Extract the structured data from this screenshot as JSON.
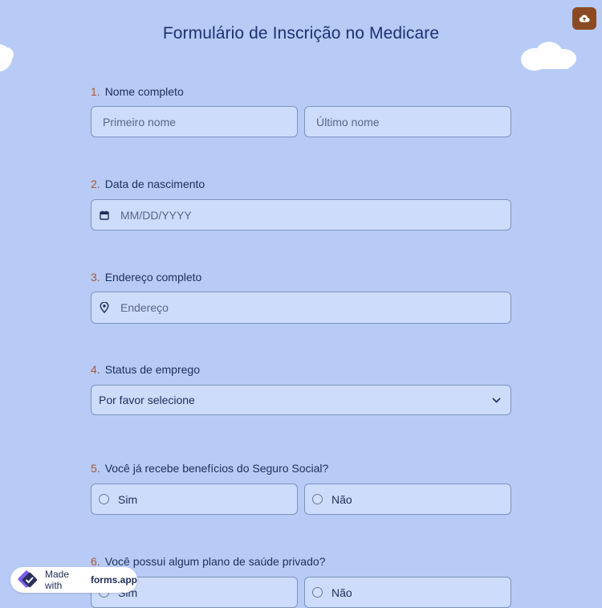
{
  "form": {
    "title": "Formulário de Inscrição no Medicare"
  },
  "toolbar": {
    "save_icon": "cloud-upload-icon"
  },
  "questions": {
    "q1": {
      "number": "1.",
      "label": "Nome completo",
      "first_placeholder": "Primeiro nome",
      "last_placeholder": "Último nome"
    },
    "q2": {
      "number": "2.",
      "label": "Data de nascimento",
      "placeholder": "MM/DD/YYYY",
      "icon": "calendar-icon"
    },
    "q3": {
      "number": "3.",
      "label": "Endereço completo",
      "placeholder": "Endereço",
      "icon": "map-pin-icon"
    },
    "q4": {
      "number": "4.",
      "label": "Status de emprego",
      "selected": "Por favor selecione",
      "icon": "chevron-down-icon"
    },
    "q5": {
      "number": "5.",
      "label": "Você já recebe benefícios do Seguro Social?",
      "options": [
        "Sim",
        "Não"
      ]
    },
    "q6": {
      "number": "6.",
      "label": "Você possui algum plano de saúde privado?",
      "options": [
        "Sim",
        "Não"
      ]
    }
  },
  "badge": {
    "prefix": "Made with",
    "brand": "forms.app"
  },
  "colors": {
    "background": "#b7cbf6",
    "field": "#cddcfb",
    "accent_number": "#b0572b",
    "title": "#1e3171",
    "save_button": "#8b4a23"
  }
}
